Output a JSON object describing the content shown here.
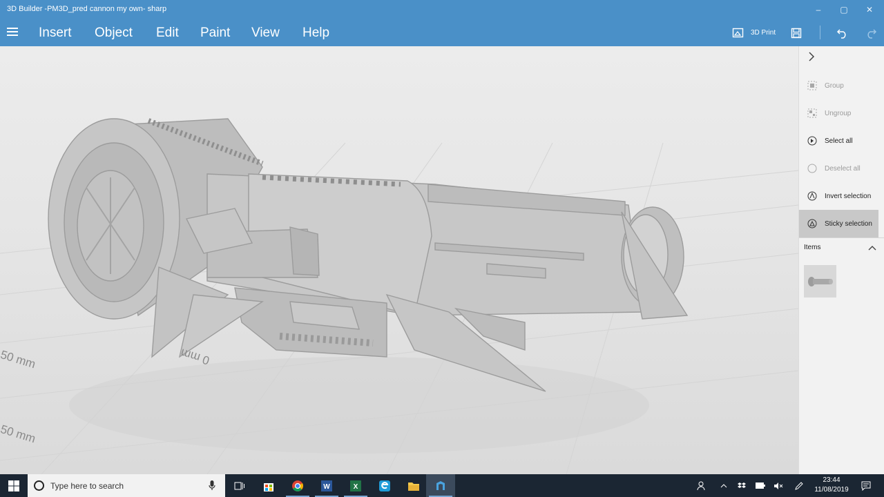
{
  "window": {
    "title": "3D Builder -PM3D_pred cannon my own- sharp",
    "controls": {
      "minimize": "–",
      "maximize": "▢",
      "close": "✕"
    }
  },
  "menu": {
    "items": [
      "Insert",
      "Object",
      "Edit",
      "Paint",
      "View",
      "Help"
    ],
    "print_label": "3D Print"
  },
  "viewport": {
    "axis_labels": [
      "50 mm",
      "0 mm",
      "50 mm"
    ]
  },
  "panel": {
    "commands": [
      {
        "label": "Group",
        "icon": "group-icon",
        "state": "disabled"
      },
      {
        "label": "Ungroup",
        "icon": "ungroup-icon",
        "state": "disabled"
      },
      {
        "label": "Select all",
        "icon": "select-all-icon",
        "state": "enabled"
      },
      {
        "label": "Deselect all",
        "icon": "deselect-all-icon",
        "state": "disabled"
      },
      {
        "label": "Invert selection",
        "icon": "invert-selection-icon",
        "state": "enabled"
      },
      {
        "label": "Sticky selection",
        "icon": "sticky-selection-icon",
        "state": "active"
      }
    ],
    "items_label": "Items"
  },
  "taskbar": {
    "search_placeholder": "Type here to search",
    "apps": [
      "task-view",
      "store",
      "chrome",
      "word",
      "excel",
      "edge",
      "file-explorer",
      "3d-builder"
    ],
    "clock_time": "23:44",
    "clock_date": "11/08/2019"
  },
  "colors": {
    "accent": "#4a90c8",
    "viewport_bg": "#e8e8e8",
    "panel_bg": "#f2f2f2",
    "taskbar_bg": "#1b2633",
    "model": "#c4c4c4"
  }
}
